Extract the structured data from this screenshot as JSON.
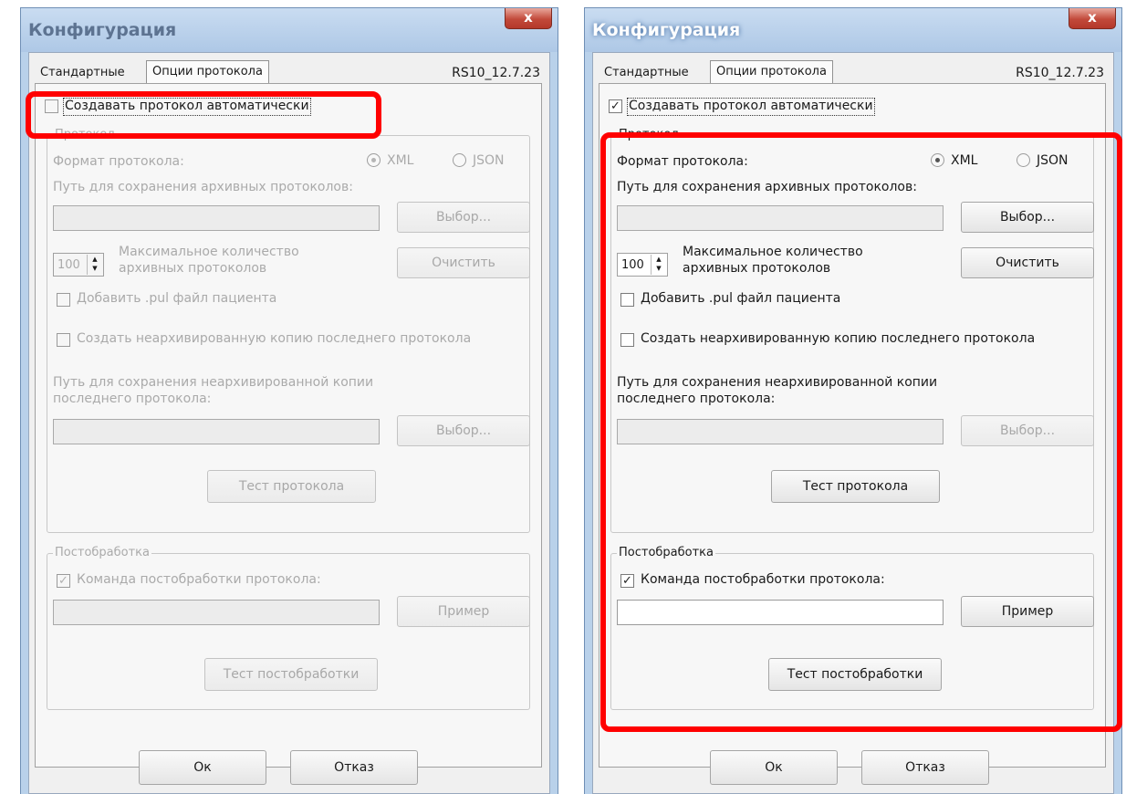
{
  "dialogs": [
    {
      "title": "Конфигурация",
      "close_label": "x",
      "tabs": [
        "Стандартные",
        "Опции протокола"
      ],
      "version": "RS10_12.7.23",
      "auto_protocol": {
        "label": "Создавать протокол автоматически",
        "checked": false
      },
      "protocol_group": {
        "title": "Протокол",
        "format_label": "Формат протокола:",
        "format_options": [
          "XML",
          "JSON"
        ],
        "format_selected": "XML",
        "archive_path_label": "Путь для сохранения архивных протоколов:",
        "archive_path_value": "",
        "select_label": "Выбор...",
        "max_count_value": "100",
        "max_count_label_1": "Максимальное количество",
        "max_count_label_2": "архивных протоколов",
        "clear_label": "Очистить",
        "add_pul_label": "Добавить .pul файл пациента",
        "add_pul_checked": false,
        "unarchived_copy_label": "Создать неархивированную копию последнего протокола",
        "unarchived_copy_checked": false,
        "unarchived_path_label_1": "Путь для сохранения неархивированной копии",
        "unarchived_path_label_2": "последнего протокола:",
        "unarchived_path_value": "",
        "select2_label": "Выбор...",
        "test_label": "Тест протокола"
      },
      "post_group": {
        "title": "Постобработка",
        "command_label": "Команда постобработки протокола:",
        "command_checked": true,
        "command_value": "",
        "example_label": "Пример",
        "test_label": "Тест постобработки"
      },
      "ok_label": "Ок",
      "cancel_label": "Отказ"
    },
    {
      "title": "Конфигурация",
      "close_label": "x",
      "tabs": [
        "Стандартные",
        "Опции протокола"
      ],
      "version": "RS10_12.7.23",
      "auto_protocol": {
        "label": "Создавать протокол автоматически",
        "checked": true
      },
      "protocol_group": {
        "title": "Протокол",
        "format_label": "Формат протокола:",
        "format_options": [
          "XML",
          "JSON"
        ],
        "format_selected": "XML",
        "archive_path_label": "Путь для сохранения архивных протоколов:",
        "archive_path_value": "",
        "select_label": "Выбор...",
        "max_count_value": "100",
        "max_count_label_1": "Максимальное количество",
        "max_count_label_2": "архивных протоколов",
        "clear_label": "Очистить",
        "add_pul_label": "Добавить .pul файл пациента",
        "add_pul_checked": false,
        "unarchived_copy_label": "Создать неархивированную копию последнего протокола",
        "unarchived_copy_checked": false,
        "unarchived_path_label_1": "Путь для сохранения неархивированной копии",
        "unarchived_path_label_2": "последнего протокола:",
        "unarchived_path_value": "",
        "select2_label": "Выбор...",
        "test_label": "Тест протокола"
      },
      "post_group": {
        "title": "Постобработка",
        "command_label": "Команда постобработки протокола:",
        "command_checked": true,
        "command_value": "",
        "example_label": "Пример",
        "test_label": "Тест постобработки"
      },
      "ok_label": "Ок",
      "cancel_label": "Отказ"
    }
  ],
  "colors": {
    "highlight": "#ff0000",
    "window_frame": "#b9d1ea",
    "close_button": "#c2493a",
    "disabled_text": "#aaaaaa"
  }
}
